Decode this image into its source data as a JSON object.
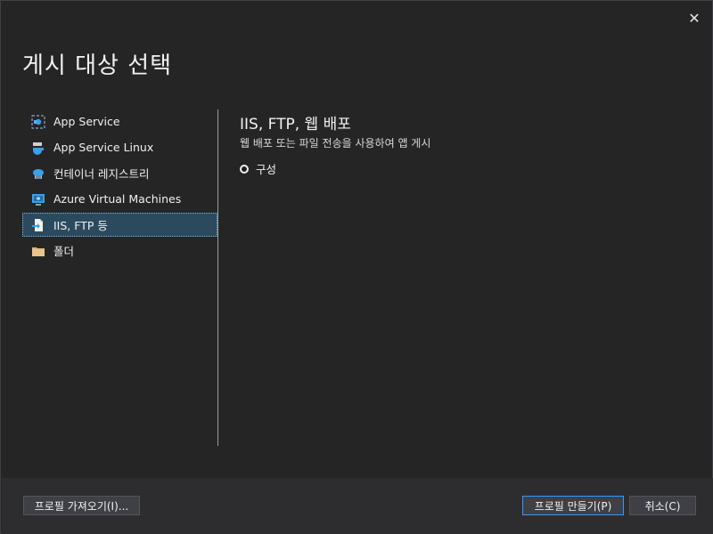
{
  "dialog": {
    "title": "게시 대상 선택",
    "close_icon": "close-icon"
  },
  "sidebar": {
    "items": [
      {
        "label": "App Service",
        "icon": "app-service-icon"
      },
      {
        "label": "App Service Linux",
        "icon": "app-service-linux-icon"
      },
      {
        "label": "컨테이너 레지스트리",
        "icon": "container-registry-icon"
      },
      {
        "label": "Azure Virtual Machines",
        "icon": "virtual-machine-icon"
      },
      {
        "label": "IIS, FTP 등",
        "icon": "iis-ftp-icon",
        "selected": true
      },
      {
        "label": "폴더",
        "icon": "folder-icon"
      }
    ]
  },
  "detail": {
    "title": "IIS, FTP, 웹 배포",
    "description": "웹 배포 또는 파일 전송을 사용하여 앱 게시",
    "option_label": "구성"
  },
  "footer": {
    "import_label": "프로필 가져오기(I)...",
    "create_label": "프로필 만들기(P)",
    "cancel_label": "취소(C)"
  },
  "colors": {
    "background": "#252526",
    "footer": "#2d2d30",
    "selected": "#2c4a5e",
    "accent": "#3399ff"
  }
}
